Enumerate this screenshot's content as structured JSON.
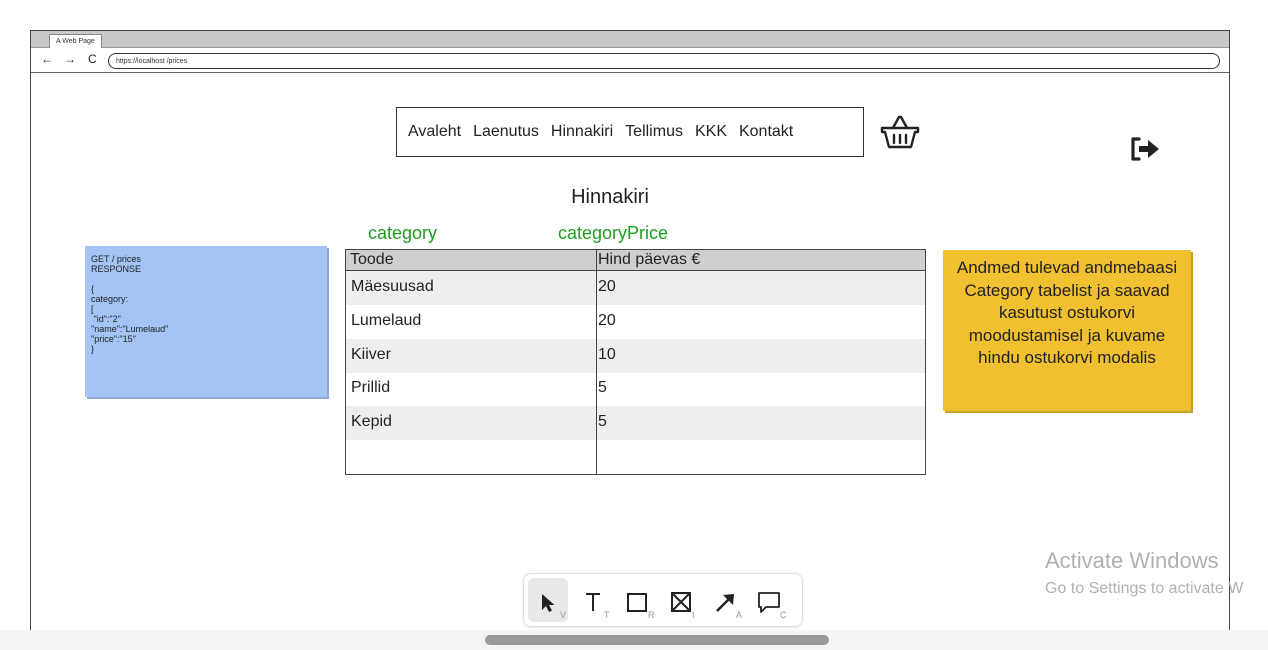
{
  "browser": {
    "tab_title": "A Web Page",
    "back": "←",
    "forward": "→",
    "reload": "C",
    "url": "https://localhost /prices"
  },
  "nav": {
    "items": [
      "Avaleht",
      "Laenutus",
      "Hinnakiri",
      "Tellimus",
      "KKK",
      "Kontakt"
    ]
  },
  "page": {
    "title": "Hinnakiri",
    "label_category": "category",
    "label_category_price": "categoryPrice"
  },
  "api_note": {
    "text": "GET / prices\nRESPONSE\n\n{\ncategory:\n[\n \"id\":\"2\"\n\"name\":\"Lumelaud\"\n\"price\":\"15\"\n}"
  },
  "table": {
    "headers": [
      "Toode",
      "Hind päevas €"
    ],
    "rows": [
      [
        "Mäesuusad",
        "20"
      ],
      [
        "Lumelaud",
        "20"
      ],
      [
        "Kiiver",
        "10"
      ],
      [
        "Prillid",
        "5"
      ],
      [
        "Kepid",
        "5"
      ]
    ]
  },
  "info_note": {
    "text": "Andmed tulevad andmebaasi Category tabelist ja saavad kasutust ostukorvi moodustamisel ja kuvame hindu ostukorvi modalis"
  },
  "watermark": {
    "line1": "Activate Windows",
    "line2": "Go to Settings to activate W"
  },
  "toolbar": {
    "tools": [
      {
        "name": "select",
        "key": "V"
      },
      {
        "name": "text",
        "key": "T"
      },
      {
        "name": "rectangle",
        "key": "R"
      },
      {
        "name": "image",
        "key": "I"
      },
      {
        "name": "arrow",
        "key": "A"
      },
      {
        "name": "comment",
        "key": "C"
      }
    ]
  },
  "colors": {
    "green_label": "#1e9e1e",
    "blue_note": "#a3c4f5",
    "yellow_note": "#f0c030",
    "table_header": "#cfcfcf"
  }
}
